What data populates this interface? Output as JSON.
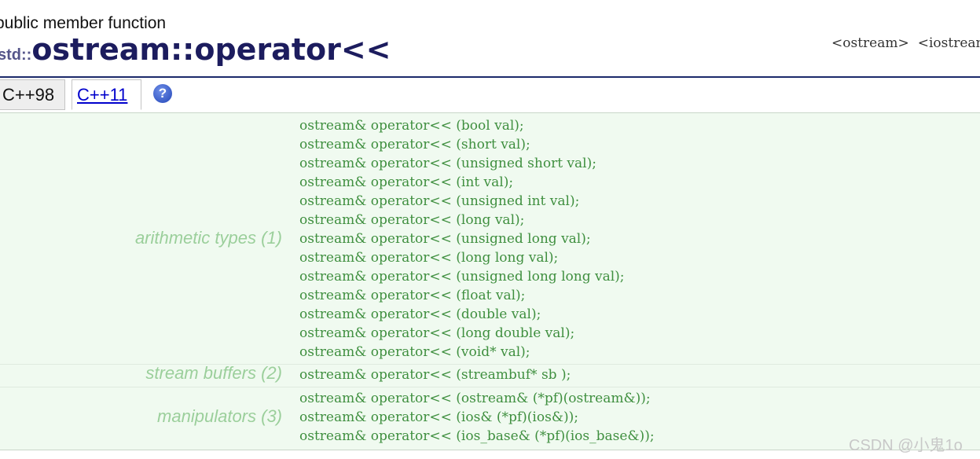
{
  "header": {
    "kind": "public member function",
    "namespace": "std::",
    "title": "ostream::operator<<",
    "headers": [
      "<ostream>",
      "<iostream>"
    ]
  },
  "tabs": [
    {
      "label": "C++98"
    },
    {
      "label": "C++11"
    }
  ],
  "help_icon": {
    "glyph": "?",
    "icon": "help-icon",
    "color": "#2346b8"
  },
  "groups": [
    {
      "label": "arithmetic types (1)",
      "lines": [
        "ostream& operator<< (bool val);",
        "ostream& operator<< (short val);",
        "ostream& operator<< (unsigned short val);",
        "ostream& operator<< (int val);",
        "ostream& operator<< (unsigned int val);",
        "ostream& operator<< (long val);",
        "ostream& operator<< (unsigned long val);",
        "ostream& operator<< (long long val);",
        "ostream& operator<< (unsigned long long val);",
        "ostream& operator<< (float val);",
        "ostream& operator<< (double val);",
        "ostream& operator<< (long double val);",
        "ostream& operator<< (void* val);"
      ]
    },
    {
      "label": "stream buffers (2)",
      "lines": [
        "ostream& operator<< (streambuf* sb );"
      ]
    },
    {
      "label": "manipulators (3)",
      "lines": [
        "ostream& operator<< (ostream& (*pf)(ostream&));",
        "ostream& operator<< (ios& (*pf)(ios&));",
        "ostream& operator<< (ios_base& (*pf)(ios_base&));"
      ]
    }
  ],
  "watermark": "CSDN @小鬼1o"
}
